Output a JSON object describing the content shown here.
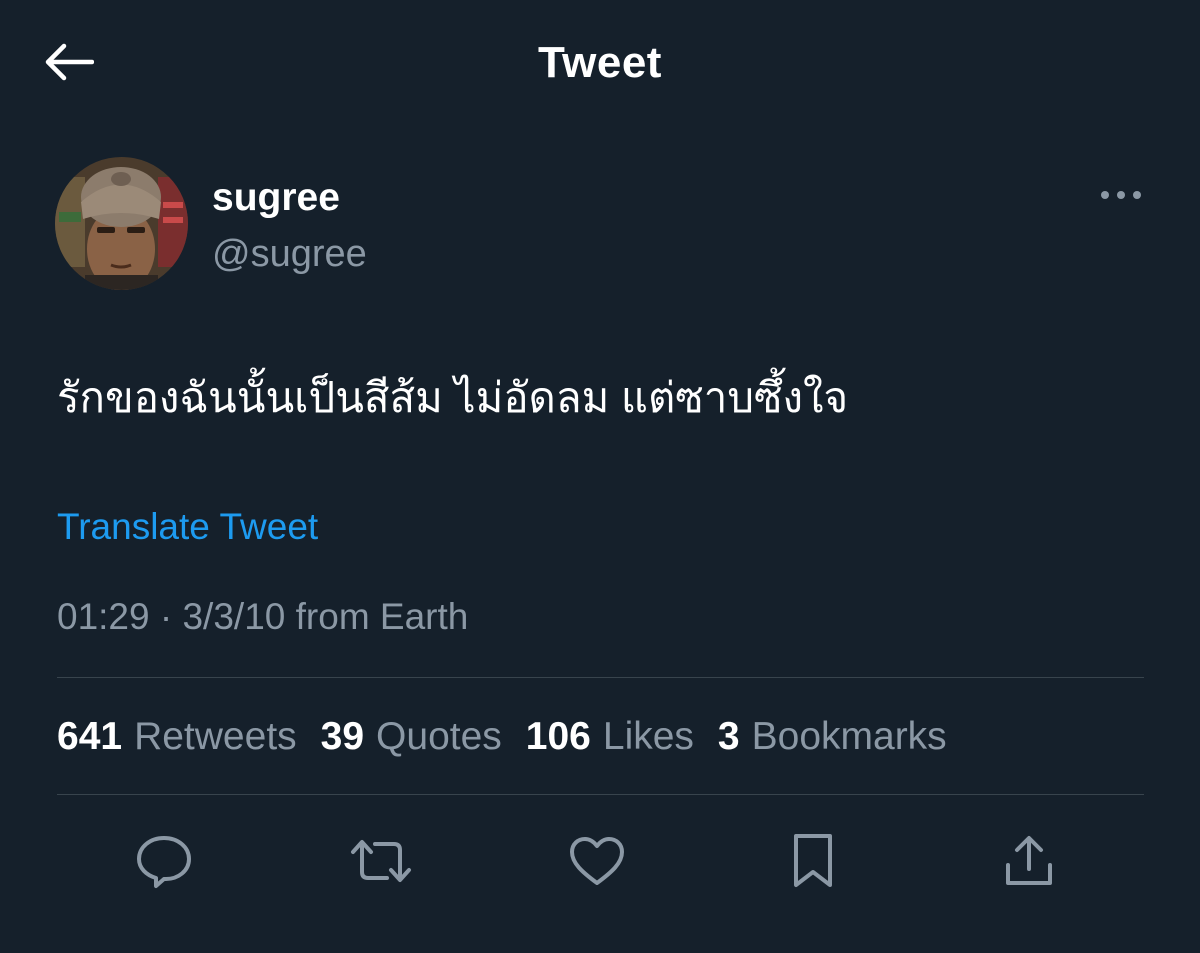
{
  "header": {
    "title": "Tweet"
  },
  "author": {
    "name": "sugree",
    "handle": "@sugree"
  },
  "tweet": {
    "text": "รักของฉันนั้นเป็นสีส้ม ไม่อัดลม แต่ซาบซึ้งใจ",
    "translate_label": "Translate Tweet",
    "time": "01:29",
    "separator": "·",
    "date": "3/3/10",
    "source_prefix": "from",
    "source": "Earth"
  },
  "stats": {
    "retweets": {
      "count": "641",
      "label": "Retweets"
    },
    "quotes": {
      "count": "39",
      "label": "Quotes"
    },
    "likes": {
      "count": "106",
      "label": "Likes"
    },
    "bookmarks": {
      "count": "3",
      "label": "Bookmarks"
    }
  },
  "icons": {
    "back": "back-arrow-icon",
    "more": "more-horizontal-icon",
    "reply": "reply-bubble-icon",
    "retweet": "retweet-icon",
    "like": "heart-icon",
    "bookmark": "bookmark-icon",
    "share": "share-icon"
  },
  "colors": {
    "background": "#15202b",
    "text_primary": "#ffffff",
    "text_secondary": "#8b98a5",
    "link": "#1d9bf0",
    "divider": "#38444d"
  }
}
